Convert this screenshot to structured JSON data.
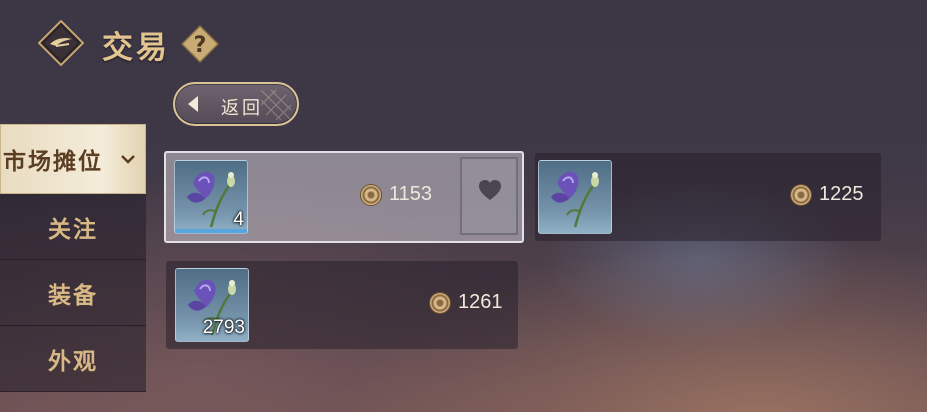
{
  "header": {
    "title": "交易"
  },
  "back_button": {
    "label": "返回"
  },
  "sidebar": {
    "items": [
      {
        "label": "市场摊位",
        "active": true
      },
      {
        "label": "关注"
      },
      {
        "label": "装备"
      },
      {
        "label": "外观"
      }
    ]
  },
  "listings": [
    {
      "quantity": "4",
      "price": "1153",
      "selected": true,
      "item_icon": "purple-flower-icon"
    },
    {
      "quantity": "",
      "price": "1225",
      "item_icon": "purple-flower-icon"
    },
    {
      "quantity": "2793",
      "price": "1261",
      "item_icon": "purple-flower-icon"
    }
  ],
  "colors": {
    "accent_gold": "#e3c590",
    "active_tab_bg": "#f4ecda",
    "qty_bar": "#57a6e0"
  }
}
